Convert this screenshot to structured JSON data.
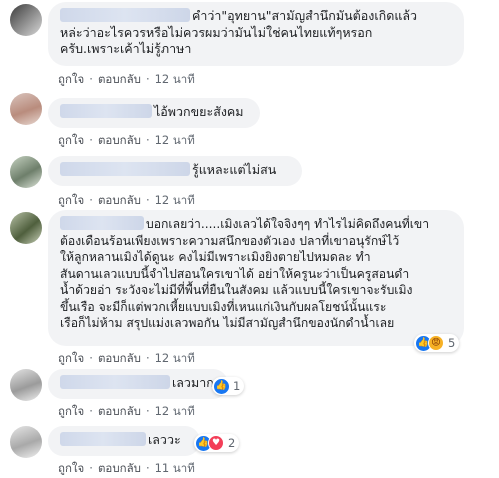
{
  "comments": [
    {
      "lines": [
        "คำว่า\"อุทยาน\"สามัญสำนึกมันต้องเกิดแล้ว",
        "หล่ะว่าอะไรควรหรือไม่ควรผมว่ามันไม่ใช่คนไทยแท้ๆหรอก",
        "ครับ.เพราะเค้าไม่รู้ภาษา"
      ],
      "like": "ถูกใจ",
      "reply": "ตอบกลับ",
      "time": "12 นาที"
    },
    {
      "lines": [
        "ไอ้พวกขยะสังคม"
      ],
      "like": "ถูกใจ",
      "reply": "ตอบกลับ",
      "time": "12 นาที"
    },
    {
      "lines": [
        "รู้แหละแต่ไม่สน"
      ],
      "like": "ถูกใจ",
      "reply": "ตอบกลับ",
      "time": "12 นาที"
    },
    {
      "lines": [
        "บอกเลยว่า.....เมิงเลวได้ใจจิงๆๆ ทำไรไม่คิดถึงคนที่เขา",
        "ต้องเดือนร้อนเพียงเพราะความสนึกของตัวเอง ปลาที่เขาอนุรักษ์ไว้",
        "ให้ลูกหลานเมิงได้ดูนะ คงไม่มีเพราะเมิงยิงตายไปหมดละ ทำ",
        "สันดานเลวแบบนี้จำไปสอนใครเขาได้ อย่าให้ครูนะว่าเป็นครูสอนดำ",
        "น้ำด้วยอ่า ระวังจะไม่มีที่พื้นที่ยืนในสังคม แล้วแบบนี้ใครเขาจะรับเมิง",
        "ขึ้นเรือ จะมีก็แต่พวกเหี้ยแบบเมิงที่เหนแก่เงินกับผลโยชน์นั้นแระ",
        "เรือก็ไม่ห้าม สรุปแม่งเลวพอกัน ไม่มีสามัญสำนึกของนักดำน้ำเลย"
      ],
      "like": "ถูกใจ",
      "reply": "ตอบกลับ",
      "time": "12 นาที",
      "reaction_count": "5"
    },
    {
      "lines": [
        "เลวมาก"
      ],
      "like": "ถูกใจ",
      "reply": "ตอบกลับ",
      "time": "12 นาที",
      "reaction_count": "1"
    },
    {
      "lines": [
        "เลววะ"
      ],
      "like": "ถูกใจ",
      "reply": "ตอบกลับ",
      "time": "11 นาที",
      "reaction_count": "2"
    }
  ],
  "icons": {
    "like": "thumbs-up-icon",
    "angry": "angry-face-icon",
    "love": "heart-icon"
  },
  "colors": {
    "bubble": "#f2f3f5",
    "link": "#4b4f56",
    "like_blue": "#1877f2",
    "love_red": "#f33e58"
  }
}
